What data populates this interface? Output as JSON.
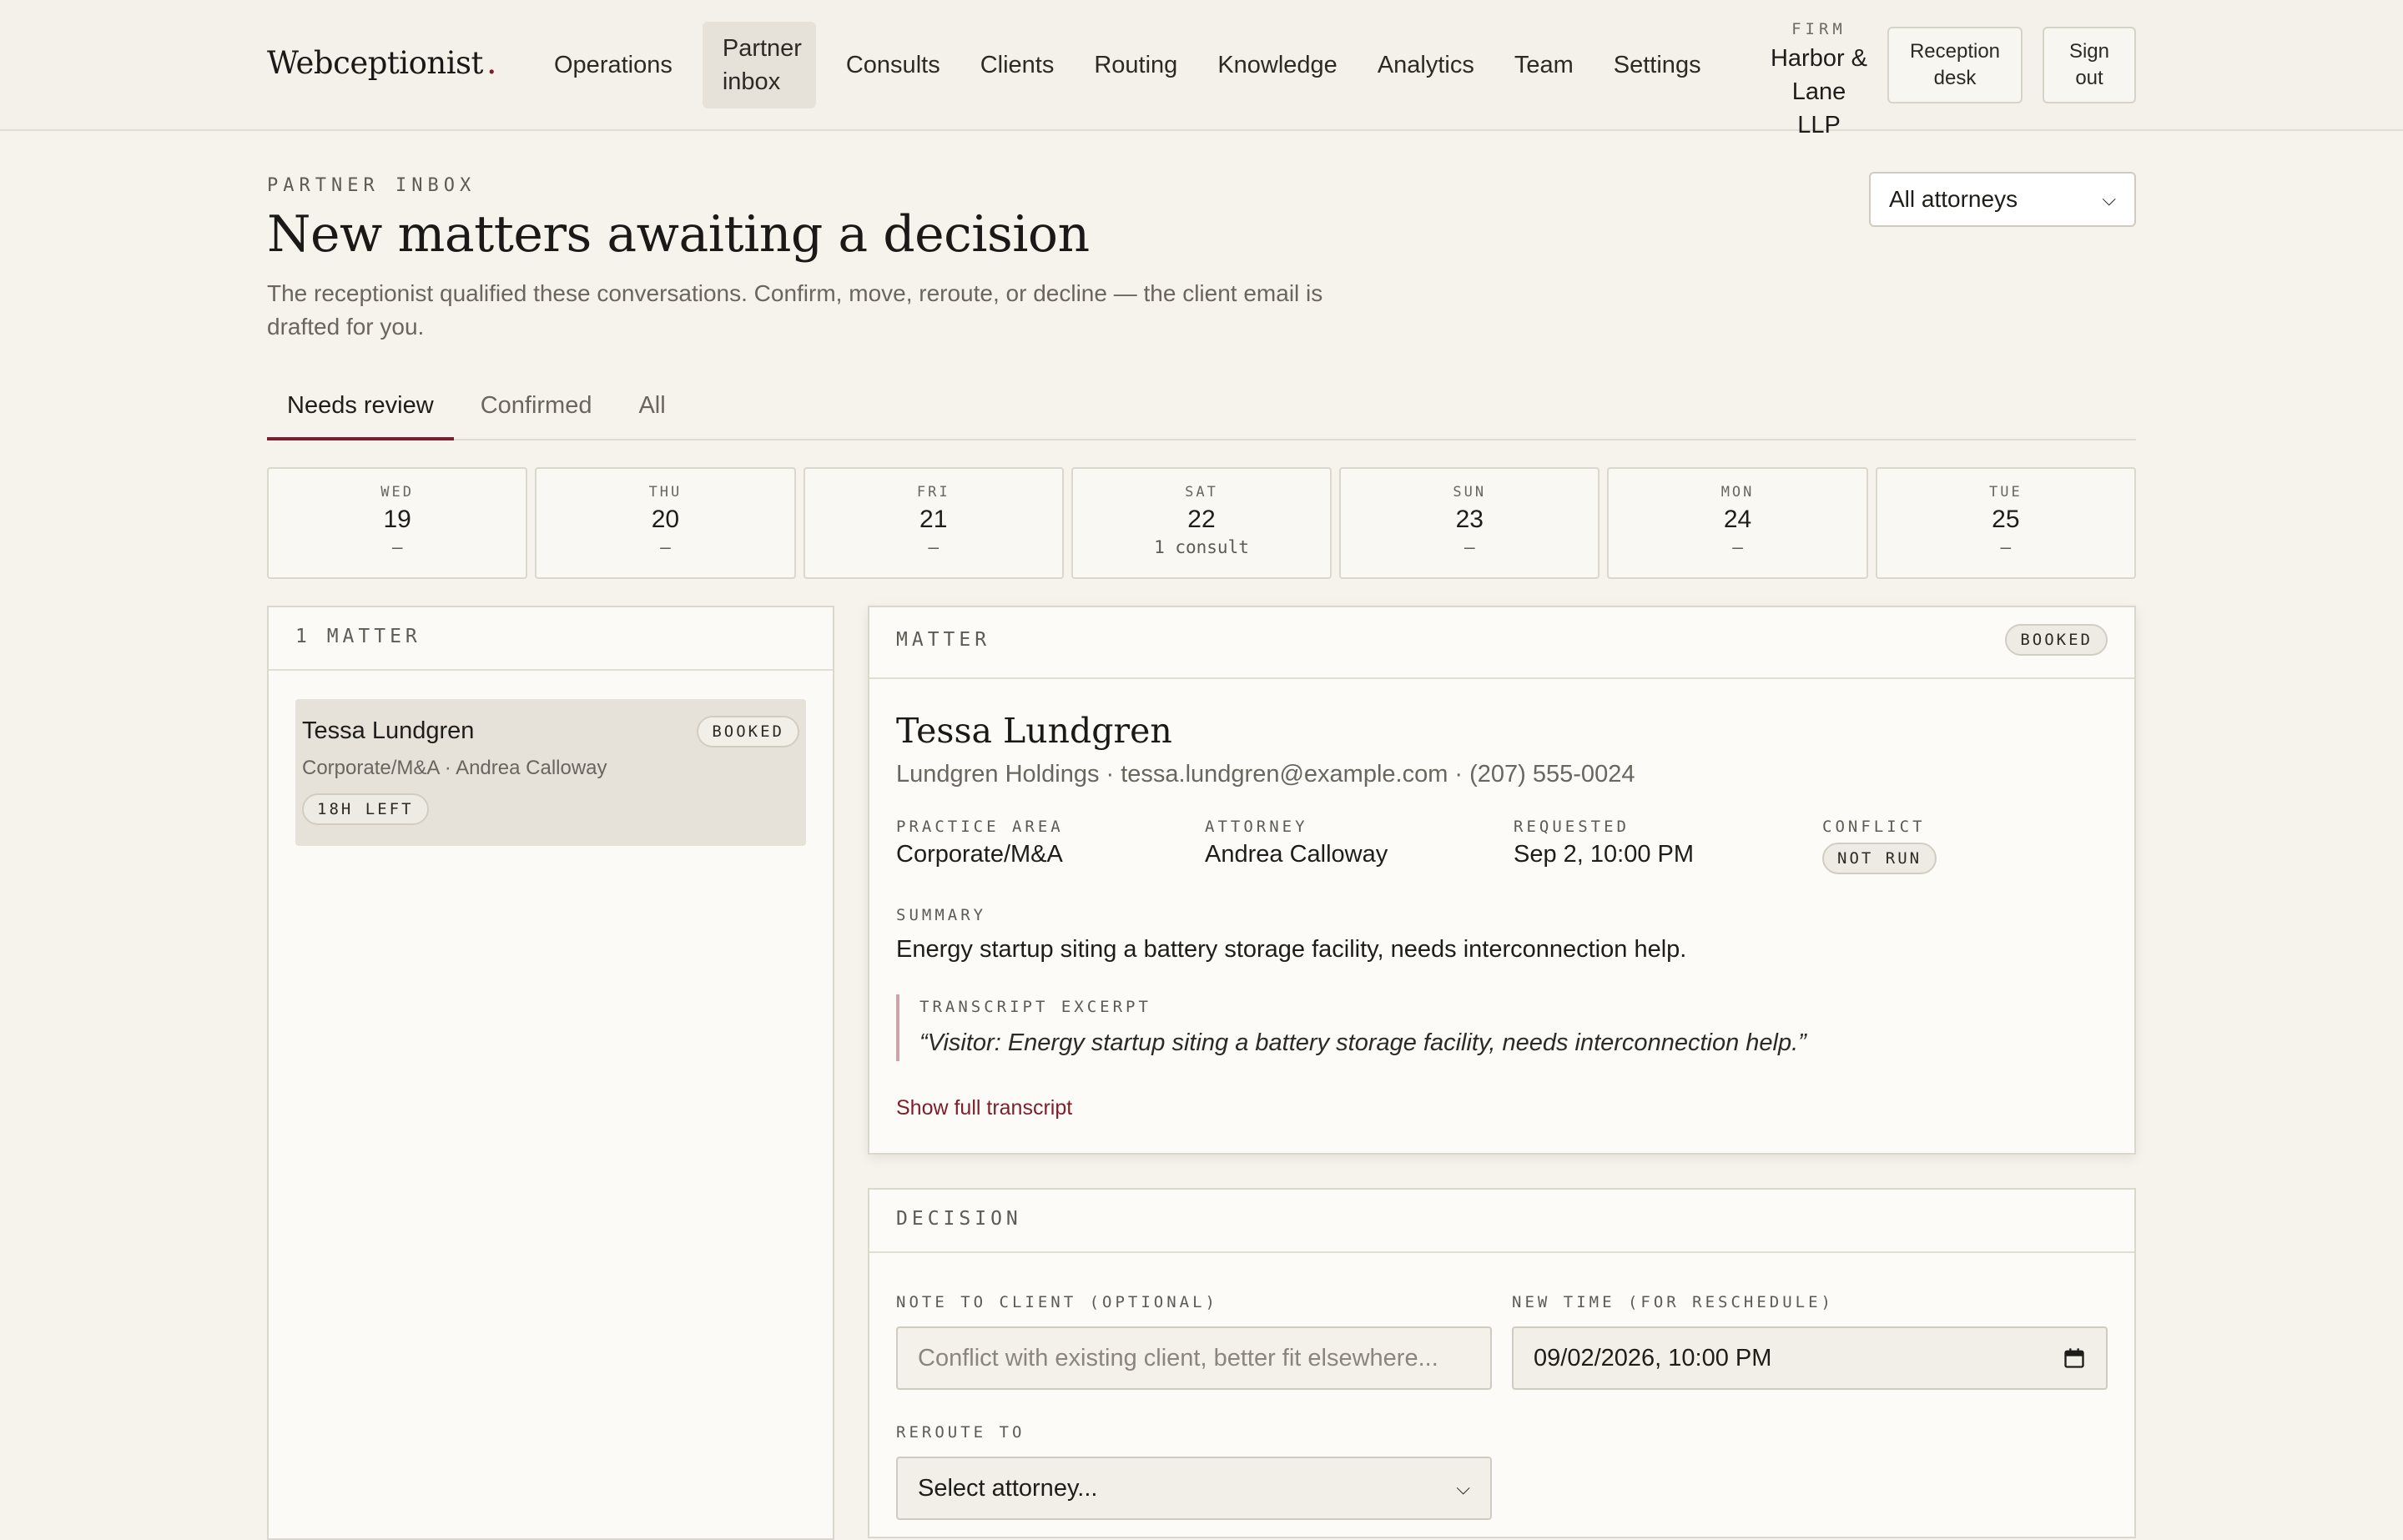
{
  "app": {
    "logo": "Webceptionist",
    "logo_dot": ".",
    "nav": [
      "Operations",
      "Partner inbox",
      "Consults",
      "Clients",
      "Routing",
      "Knowledge",
      "Analytics",
      "Team",
      "Settings"
    ],
    "active_nav": "Partner inbox",
    "firm_label": "FIRM",
    "firm_name": "Harbor & Lane LLP",
    "reception_desk": "Reception desk",
    "sign_out": "Sign out"
  },
  "page": {
    "eyebrow": "PARTNER INBOX",
    "title": "New matters awaiting a decision",
    "subtitle": "The receptionist qualified these conversations. Confirm, move, reroute, or decline — the client email is drafted for you.",
    "attorney_filter": "All attorneys"
  },
  "tabs": [
    {
      "label": "Needs review",
      "active": true
    },
    {
      "label": "Confirmed",
      "active": false
    },
    {
      "label": "All",
      "active": false
    }
  ],
  "days": [
    {
      "dow": "WED",
      "num": "19",
      "count": "—"
    },
    {
      "dow": "THU",
      "num": "20",
      "count": "—"
    },
    {
      "dow": "FRI",
      "num": "21",
      "count": "—"
    },
    {
      "dow": "SAT",
      "num": "22",
      "count": "1 consult"
    },
    {
      "dow": "SUN",
      "num": "23",
      "count": "—"
    },
    {
      "dow": "MON",
      "num": "24",
      "count": "—"
    },
    {
      "dow": "TUE",
      "num": "25",
      "count": "—"
    }
  ],
  "list": {
    "header": "1 MATTER",
    "items": [
      {
        "name": "Tessa Lundgren",
        "meta": "Corporate/M&A · Andrea Calloway",
        "badge": "BOOKED",
        "time_left": "18H LEFT"
      }
    ]
  },
  "detail": {
    "header": "MATTER",
    "badge": "BOOKED",
    "name": "Tessa Lundgren",
    "contact": "Lundgren Holdings · tessa.lundgren@example.com · (207) 555-0024",
    "fields": {
      "practice_label": "PRACTICE AREA",
      "practice_value": "Corporate/M&A",
      "attorney_label": "ATTORNEY",
      "attorney_value": "Andrea Calloway",
      "requested_label": "REQUESTED",
      "requested_value": "Sep 2, 10:00 PM",
      "conflict_label": "CONFLICT",
      "conflict_value": "NOT RUN"
    },
    "summary_label": "SUMMARY",
    "summary": "Energy startup siting a battery storage facility, needs interconnection help.",
    "excerpt_label": "TRANSCRIPT EXCERPT",
    "excerpt": "“Visitor: Energy startup siting a battery storage facility, needs interconnection help.”",
    "show_transcript": "Show full transcript"
  },
  "decision": {
    "header": "DECISION",
    "note_label": "NOTE TO CLIENT (OPTIONAL)",
    "note_placeholder": "Conflict with existing client, better fit elsewhere...",
    "time_label": "NEW TIME (FOR RESCHEDULE)",
    "time_value": "09/02/2026, 10:00 PM",
    "reroute_label": "REROUTE TO",
    "reroute_value": "Select attorney..."
  }
}
